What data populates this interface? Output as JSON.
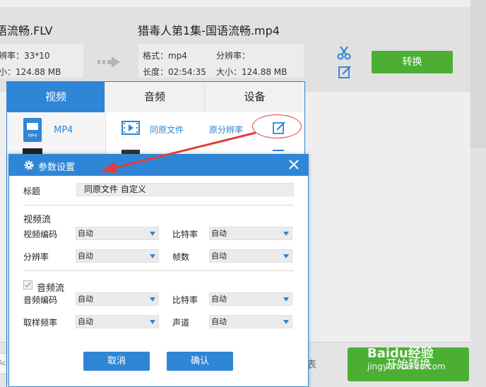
{
  "file_row": {
    "source_name": "语流畅.FLV",
    "source_res": "辨率：33*10",
    "source_size": "小：124.88 MB",
    "target_name": "猎毒人第1集-国语流畅.mp4",
    "format_label": "格式：mp4",
    "resolution_label": "分辨率：",
    "duration_label": "长度：02:54:35",
    "size_label": "大小：124.88 MB",
    "convert_label": "转换"
  },
  "format_panel": {
    "tabs": [
      "视频",
      "音频",
      "设备"
    ],
    "active_tab": 0,
    "left_item_label": "MP4",
    "left_icon_text": "MP4",
    "row_label_same": "同原文件",
    "row_label_res": "原分辨率"
  },
  "dialog": {
    "title": "参数设置",
    "title_label": "标题",
    "title_value": "同原文件 自定义",
    "video_section": "视频流",
    "video_codec_label": "视频编码",
    "video_codec_value": "自动",
    "video_bitrate_label": "比特率",
    "video_bitrate_value": "自动",
    "resolution_label": "分辨率",
    "resolution_value": "自动",
    "fps_label": "帧数",
    "fps_value": "自动",
    "audio_section": "音频流",
    "audio_enabled": true,
    "audio_codec_label": "音频编码",
    "audio_codec_value": "自动",
    "audio_bitrate_label": "比特率",
    "audio_bitrate_value": "自动",
    "sample_rate_label": "取样频率",
    "sample_rate_value": "自动",
    "channel_label": "声道",
    "channel_value": "自动",
    "cancel_label": "取消",
    "confirm_label": "确认"
  },
  "bottom": {
    "input_text": "Ac",
    "side_text": "表",
    "merge_label": "开始转换"
  },
  "watermark": {
    "brand": "Baidu经验",
    "url": "jingyan.baidu.com"
  },
  "colors": {
    "accent": "#2f86d6",
    "green": "#4caf34",
    "annotation_red": "#e23c3c"
  }
}
